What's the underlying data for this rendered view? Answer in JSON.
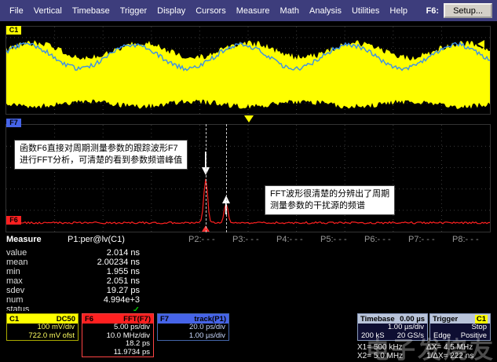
{
  "menu": {
    "items": [
      "File",
      "Vertical",
      "Timebase",
      "Trigger",
      "Display",
      "Cursors",
      "Measure",
      "Math",
      "Analysis",
      "Utilities",
      "Help"
    ],
    "right_label": "F6:",
    "setup_button": "Setup..."
  },
  "traces": {
    "c1": "C1",
    "f7": "F7",
    "f6": "F6"
  },
  "annotations": {
    "note1_line1": "函数F6直接对周期测量参数的跟踪波形F7",
    "note1_line2": "进行FFT分析，可清楚的看到参数频谱峰值",
    "note2_line1": "FFT波形很清楚的分辨出了周期",
    "note2_line2": "测量参数的干扰源的频谱"
  },
  "measure": {
    "title": "Measure",
    "p_headers": [
      "P1:per@lv(C1)",
      "P2:- - -",
      "P3:- - -",
      "P4:- - -",
      "P5:- - -",
      "P6:- - -",
      "P7:- - -",
      "P8:- - -"
    ],
    "row_labels": [
      "value",
      "mean",
      "min",
      "max",
      "sdev",
      "num",
      "status"
    ],
    "p1_values": [
      "2.014 ns",
      "2.00234 ns",
      "1.955 ns",
      "2.051 ns",
      "19.27 ps",
      "4.994e+3"
    ],
    "status_icon": "✓"
  },
  "descriptors": {
    "c1": {
      "title": "C1",
      "coupling": "DC50",
      "line1": "100 mV/div",
      "line2": "722.0 mV ofst"
    },
    "f6": {
      "title": "F6",
      "func": "FFT(F7)",
      "line1": "5.00 ps/div",
      "line2": "10.0 MHz/div",
      "readout1": "18.2 ps",
      "readout2": "11.9734 ps"
    },
    "f7": {
      "title": "F7",
      "func": "track(P1)",
      "line1": "20.0 ps/div",
      "line2": "1.00 µs/div"
    },
    "timebase": {
      "title": "Timebase",
      "value": "0.00 µs",
      "line1": "1.00 µs/div",
      "samples": "200 kS",
      "rate": "20 GS/s"
    },
    "trigger": {
      "title": "Trigger",
      "source": "C1",
      "mode": "Stop",
      "type": "Edge",
      "slope": "Positive"
    }
  },
  "cursor_readout": {
    "x1": "X1=  500 kHz",
    "dx": "ΔX=  4.5 MHz",
    "x2": "X2=  5.0 MHz",
    "invdx": "1/ΔX=  222 ns"
  },
  "watermark": "电子发烧友",
  "colors": {
    "c1_yellow": "#ffff00",
    "f6_red": "#ff2020",
    "f7_blue": "#4664e8",
    "menu_bg": "#3d3d7c",
    "status_green": "#00d000"
  }
}
